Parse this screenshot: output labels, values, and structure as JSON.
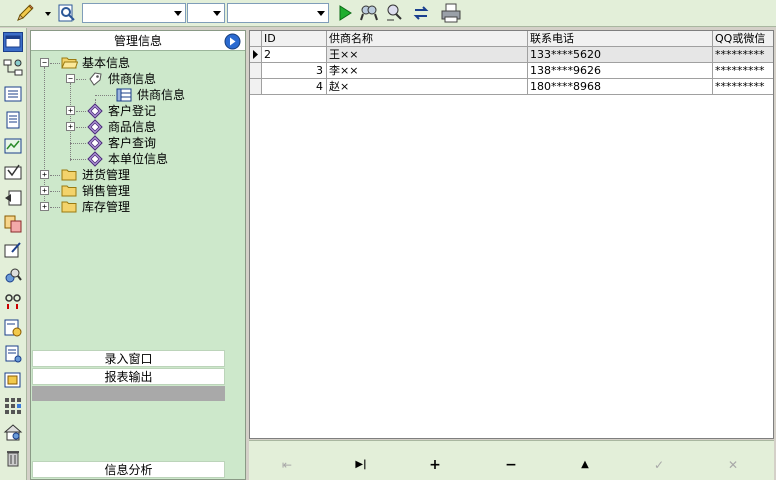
{
  "toolbar": {
    "combo1_value": "",
    "combo2_value": "",
    "combo3_value": ""
  },
  "side_panel": {
    "header_title": "管理信息",
    "tree": [
      {
        "label": "基本信息"
      },
      {
        "label": "供商信息"
      },
      {
        "label": "供商信息"
      },
      {
        "label": "客户登记"
      },
      {
        "label": "商品信息"
      },
      {
        "label": "客户查询"
      },
      {
        "label": "本单位信息"
      },
      {
        "label": "进货管理"
      },
      {
        "label": "销售管理"
      },
      {
        "label": "库存管理"
      }
    ],
    "sections": [
      "录入窗口",
      "报表输出",
      "信息分析"
    ]
  },
  "grid": {
    "columns": [
      "ID",
      "供商名称",
      "联系电话",
      "QQ或微信"
    ],
    "rows": [
      {
        "id": "2",
        "name": "王××",
        "phone": "133****5620",
        "qq": "*********"
      },
      {
        "id": "3",
        "name": "李××",
        "phone": "138****9626",
        "qq": "*********"
      },
      {
        "id": "4",
        "name": "赵×",
        "phone": "180****8968",
        "qq": "*********"
      }
    ]
  },
  "navigator": {
    "first": "⇤",
    "last": "▶|",
    "add": "+",
    "remove": "−",
    "up": "▲",
    "post": "✓",
    "cancel": "✕"
  },
  "colors": {
    "panel_green": "#cde8cb",
    "toolbar_green": "#e3efd9",
    "selected_row": "#e6e6e6"
  }
}
